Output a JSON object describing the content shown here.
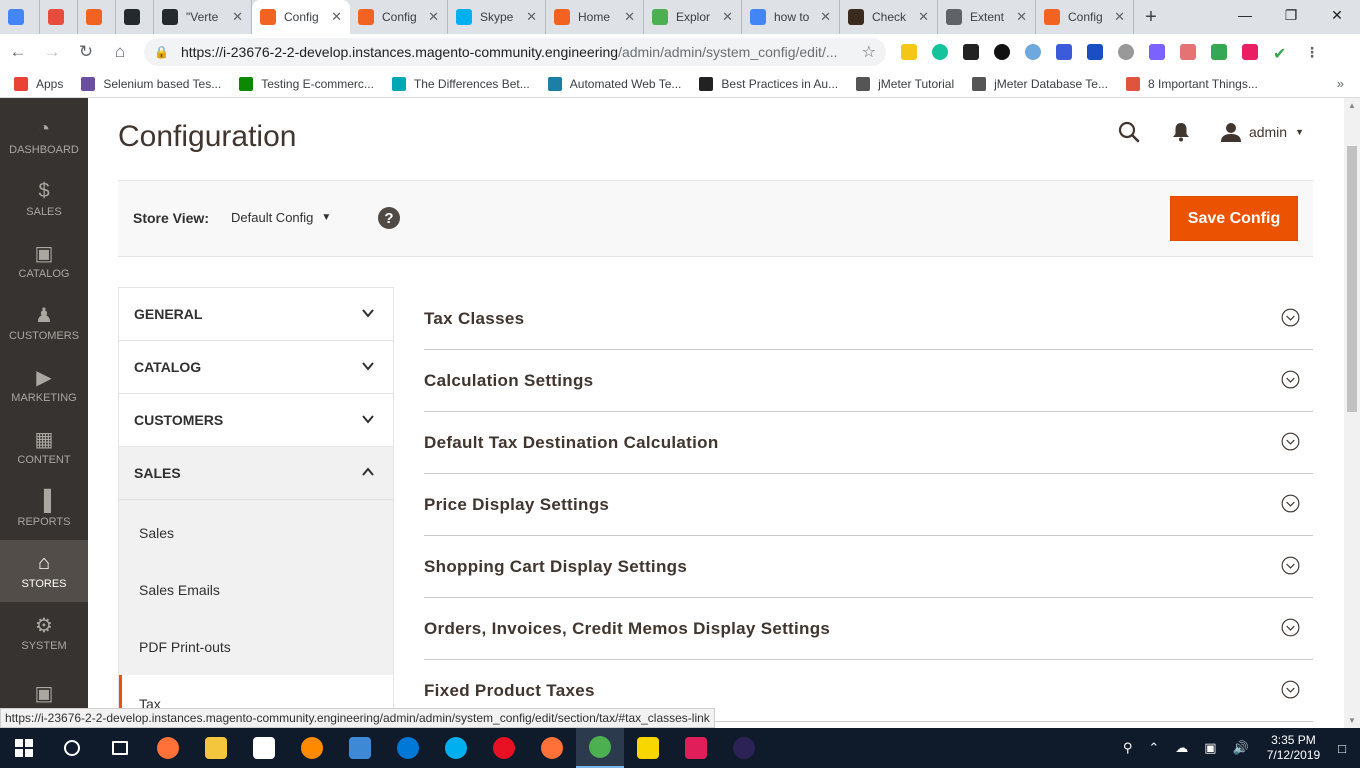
{
  "browser": {
    "tabs": [
      {
        "title": "",
        "color": "#4285f4",
        "kind": "first"
      },
      {
        "title": "",
        "color": "#e84c3d",
        "kind": "mini"
      },
      {
        "title": "",
        "color": "#f26322",
        "kind": "mini"
      },
      {
        "title": "",
        "color": "#24292e",
        "kind": "mini"
      },
      {
        "title": "\"Verte",
        "color": "#24292e",
        "kind": "std"
      },
      {
        "title": "Config",
        "color": "#f26322",
        "kind": "std",
        "active": true
      },
      {
        "title": "Config",
        "color": "#f26322",
        "kind": "std"
      },
      {
        "title": "Skype",
        "color": "#00aff0",
        "kind": "std"
      },
      {
        "title": "Home",
        "color": "#f26322",
        "kind": "std"
      },
      {
        "title": "Explor",
        "color": "#4caf50",
        "kind": "std"
      },
      {
        "title": "how to",
        "color": "#4285f4",
        "kind": "std"
      },
      {
        "title": "Check",
        "color": "#3b2b1f",
        "kind": "std"
      },
      {
        "title": "Extent",
        "color": "#5f6368",
        "kind": "std"
      },
      {
        "title": "Config",
        "color": "#f26322",
        "kind": "std"
      }
    ],
    "address": {
      "url_main": "https://i-23676-2-2-develop.instances.magento-community.engineering",
      "url_path": "/admin/admin/system_config/edit/..."
    },
    "bookmarks": [
      {
        "label": "Apps",
        "color": "#ea4335"
      },
      {
        "label": "Selenium based Tes...",
        "color": "#6b4fa1"
      },
      {
        "label": "Testing E-commerc...",
        "color": "#0b8a00"
      },
      {
        "label": "The Differences Bet...",
        "color": "#00a7b5"
      },
      {
        "label": "Automated Web Te...",
        "color": "#1b7fa6"
      },
      {
        "label": "Best Practices in Au...",
        "color": "#222222"
      },
      {
        "label": "jMeter Tutorial",
        "color": "#555555"
      },
      {
        "label": "jMeter Database Te...",
        "color": "#555555"
      },
      {
        "label": "8 Important Things...",
        "color": "#e0533c"
      }
    ]
  },
  "admin_menu": [
    {
      "label": "DASHBOARD",
      "icon": "dashboard-icon"
    },
    {
      "label": "SALES",
      "icon": "dollar-icon"
    },
    {
      "label": "CATALOG",
      "icon": "box-icon"
    },
    {
      "label": "CUSTOMERS",
      "icon": "person-icon"
    },
    {
      "label": "MARKETING",
      "icon": "megaphone-icon"
    },
    {
      "label": "CONTENT",
      "icon": "content-icon"
    },
    {
      "label": "REPORTS",
      "icon": "bar-chart-icon"
    },
    {
      "label": "STORES",
      "icon": "store-icon",
      "active": true
    },
    {
      "label": "SYSTEM",
      "icon": "gear-icon"
    }
  ],
  "page": {
    "title": "Configuration",
    "user": "admin"
  },
  "store_bar": {
    "label": "Store View:",
    "value": "Default Config",
    "save_label": "Save Config"
  },
  "config_tabs": [
    {
      "label": "GENERAL",
      "open": false
    },
    {
      "label": "CATALOG",
      "open": false
    },
    {
      "label": "CUSTOMERS",
      "open": false
    },
    {
      "label": "SALES",
      "open": true
    }
  ],
  "sales_subitems": [
    "Sales",
    "Sales Emails",
    "PDF Print-outs",
    "Tax"
  ],
  "sections": [
    "Tax Classes",
    "Calculation Settings",
    "Default Tax Destination Calculation",
    "Price Display Settings",
    "Shopping Cart Display Settings",
    "Orders, Invoices, Credit Memos Display Settings",
    "Fixed Product Taxes"
  ],
  "status_bar": {
    "url": "https://i-23676-2-2-develop.instances.magento-community.engineering/admin/admin/system_config/edit/section/tax/#tax_classes-link"
  },
  "taskbar": {
    "apps": [
      {
        "name": "cortana",
        "color": "#ffffff"
      },
      {
        "name": "task-view",
        "color": "#ffffff"
      },
      {
        "name": "firefox",
        "color": "#ff7139"
      },
      {
        "name": "file-explorer",
        "color": "#f4c63d"
      },
      {
        "name": "store",
        "color": "#ffffff"
      },
      {
        "name": "app-orange",
        "color": "#ff8a00"
      },
      {
        "name": "outlook",
        "color": "#3e89d6"
      },
      {
        "name": "edge",
        "color": "#0078d7"
      },
      {
        "name": "skype",
        "color": "#00aff0"
      },
      {
        "name": "opera",
        "color": "#e81123"
      },
      {
        "name": "firefox-dev",
        "color": "#ff7139"
      },
      {
        "name": "chrome",
        "color": "#4caf50",
        "active": true
      },
      {
        "name": "sticky-notes",
        "color": "#f8d600"
      },
      {
        "name": "slack",
        "color": "#e01e5a"
      },
      {
        "name": "eclipse",
        "color": "#2c2255"
      }
    ],
    "time": "3:35 PM",
    "date": "7/12/2019"
  }
}
